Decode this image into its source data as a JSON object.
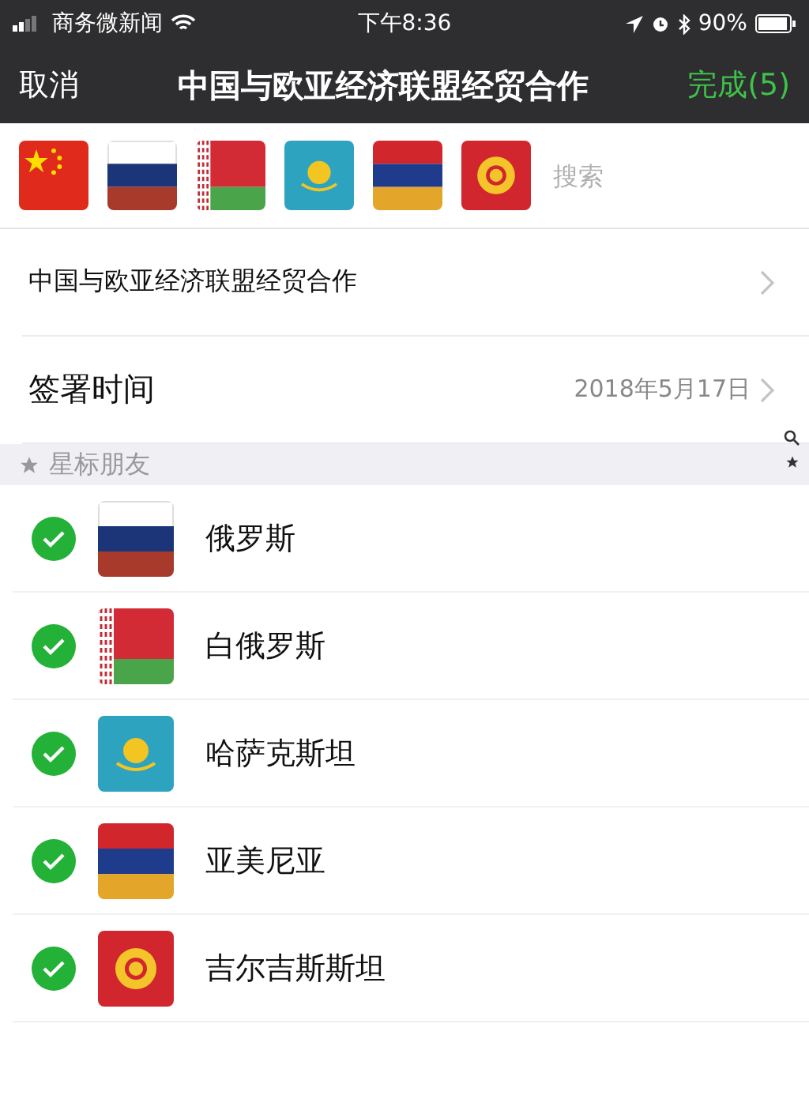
{
  "status_bar": {
    "carrier": "商务微新闻",
    "time": "下午8:36",
    "battery": "90%"
  },
  "nav": {
    "cancel": "取消",
    "title": "中国与欧亚经济联盟经贸合作",
    "done": "完成(5)"
  },
  "selected_flags": [
    {
      "kind": "china"
    },
    {
      "kind": "russia"
    },
    {
      "kind": "belarus"
    },
    {
      "kind": "kazakhstan"
    },
    {
      "kind": "armenia"
    },
    {
      "kind": "kyrgyzstan"
    }
  ],
  "search": {
    "placeholder": "搜索"
  },
  "rows": [
    {
      "label": "中国与欧亚经济联盟经贸合作",
      "kind": "title"
    },
    {
      "label": "签署时间",
      "value": "2018年5月17日",
      "kind": "date"
    }
  ],
  "section": {
    "label": "星标朋友"
  },
  "contacts": [
    {
      "name": "俄罗斯",
      "flag": {
        "kind": "russia"
      },
      "checked": true
    },
    {
      "name": "白俄罗斯",
      "flag": {
        "kind": "belarus"
      },
      "checked": true
    },
    {
      "name": "哈萨克斯坦",
      "flag": {
        "kind": "kazakhstan"
      },
      "checked": true
    },
    {
      "name": "亚美尼亚",
      "flag": {
        "kind": "armenia"
      },
      "checked": true
    },
    {
      "name": "吉尔吉斯斯坦",
      "flag": {
        "kind": "kyrgyzstan"
      },
      "checked": true
    }
  ]
}
